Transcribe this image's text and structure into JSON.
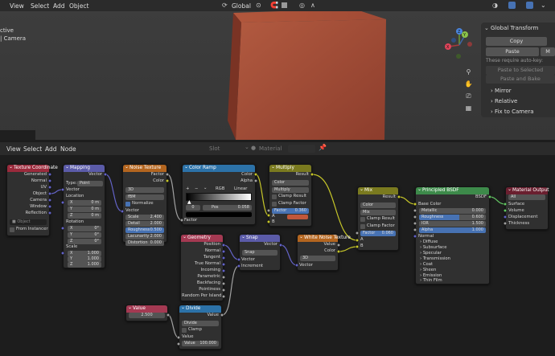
{
  "viewport": {
    "menu": [
      "View",
      "Select",
      "Add",
      "Object"
    ],
    "orientation": "Global",
    "left_text1": "ctive",
    "left_text2": "| Camera",
    "gizmo": {
      "x": "X",
      "y": "Y",
      "z": "Z"
    }
  },
  "npanel": {
    "title": "Global Transform",
    "copy": "Copy",
    "paste": "Paste",
    "m": "M",
    "note": "These require auto-key:",
    "paste_sel": "Paste to Selected",
    "paste_bake": "Paste and Bake",
    "mirror": "Mirror",
    "relative": "Relative",
    "fix_camera": "Fix to Camera"
  },
  "editor_header": {
    "menu": [
      "View",
      "Select",
      "Add",
      "Node"
    ],
    "slot": "Slot",
    "material": "Material"
  },
  "colors": {
    "texcoord": "#9a2a3c",
    "vector": "#5b5ba8",
    "texture": "#b3651f",
    "converter": "#2c72a8",
    "shader": "#3d8a4a",
    "input": "#a43952",
    "color": "#7a7a1f",
    "output": "#6a1f2f",
    "socket_vec": "#6363c7",
    "socket_col": "#c7c729",
    "socket_float": "#a1a1a1",
    "socket_shader": "#63c763"
  },
  "nodes": {
    "texcoord": {
      "title": "Texture Coordinate",
      "outputs": [
        "Generated",
        "Normal",
        "UV",
        "Object",
        "Camera",
        "Window",
        "Reflection"
      ],
      "object_label": "Object",
      "from_instancer": "From Instancer"
    },
    "mapping": {
      "title": "Mapping",
      "out": "Vector",
      "type_label": "Type:",
      "type_value": "Point",
      "vector": "Vector",
      "location": "Location",
      "loc": [
        [
          "X",
          "0 m"
        ],
        [
          "Y",
          "0 m"
        ],
        [
          "Z",
          "0 m"
        ]
      ],
      "rotation": "Rotation",
      "rot": [
        [
          "X",
          "0°"
        ],
        [
          "Y",
          "0°"
        ],
        [
          "Z",
          "0°"
        ]
      ],
      "scale": "Scale",
      "scl": [
        [
          "X",
          "1.000"
        ],
        [
          "Y",
          "1.000"
        ],
        [
          "Z",
          "1.000"
        ]
      ]
    },
    "noise": {
      "title": "Noise Texture",
      "outs": [
        "Factor",
        "Color"
      ],
      "dim": "3D",
      "basis": "fBM",
      "normalize": "Normalize",
      "vector": "Vector",
      "fields": [
        [
          "Scale",
          "2.400"
        ],
        [
          "Detail",
          "2.000"
        ],
        [
          "Roughness",
          "0.500"
        ],
        [
          "Lacunarity",
          "2.000"
        ],
        [
          "Distortion",
          "0.000"
        ]
      ]
    },
    "ramp": {
      "title": "Color Ramp",
      "outs": [
        "Color",
        "Alpha"
      ],
      "plus": "+",
      "minus": "−",
      "caret": "⌄",
      "mode": "RGB",
      "interp": "Linear",
      "idx": "0",
      "pos_label": "Pos",
      "pos_value": "0.058",
      "factor": "Factor"
    },
    "multiply": {
      "title": "Multiply",
      "out": "Result",
      "type": "Color",
      "blend": "Multiply",
      "clamp_result": "Clamp Result",
      "clamp_factor": "Clamp Factor",
      "factor_label": "Factor",
      "factor_value": "0.360",
      "a": "A",
      "b": "B"
    },
    "geometry": {
      "title": "Geometry",
      "outs": [
        "Position",
        "Normal",
        "Tangent",
        "True Normal",
        "Incoming",
        "Parametric",
        "Backfacing",
        "Pointiness",
        "Random Per Island"
      ]
    },
    "snap": {
      "title": "Snap",
      "out": "Vector",
      "op": "Snap",
      "vector": "Vector",
      "increment": "Increment"
    },
    "white": {
      "title": "White Noise Texture",
      "outs": [
        "Value",
        "Color"
      ],
      "dim": "3D",
      "vector": "Vector"
    },
    "mix": {
      "title": "Mix",
      "out": "Result",
      "type": "Color",
      "blend": "Mix",
      "clamp_result": "Clamp Result",
      "clamp_factor": "Clamp Factor",
      "factor_label": "Factor",
      "factor_value": "0.060",
      "a": "A",
      "b": "B"
    },
    "bsdf": {
      "title": "Principled BSDF",
      "out": "BSDF",
      "base_color": "Base Color",
      "fields": [
        [
          "Metallic",
          "0.000"
        ],
        [
          "Roughness",
          "0.600"
        ],
        [
          "IOR",
          "1.500"
        ],
        [
          "Alpha",
          "1.000"
        ]
      ],
      "normal": "Normal",
      "subs": [
        "Diffuse",
        "Subsurface",
        "Specular",
        "Transmission",
        "Coat",
        "Sheen",
        "Emission",
        "Thin Film"
      ]
    },
    "output": {
      "title": "Material Output",
      "target": "All",
      "ins": [
        "Surface",
        "Volume",
        "Displacement",
        "Thickness"
      ]
    },
    "value": {
      "title": "Value",
      "out": "Value",
      "value": "2.500"
    },
    "divide": {
      "title": "Divide",
      "out": "Value",
      "op": "Divide",
      "clamp": "Clamp",
      "value_label": "Value",
      "value_value": "100.000"
    }
  }
}
